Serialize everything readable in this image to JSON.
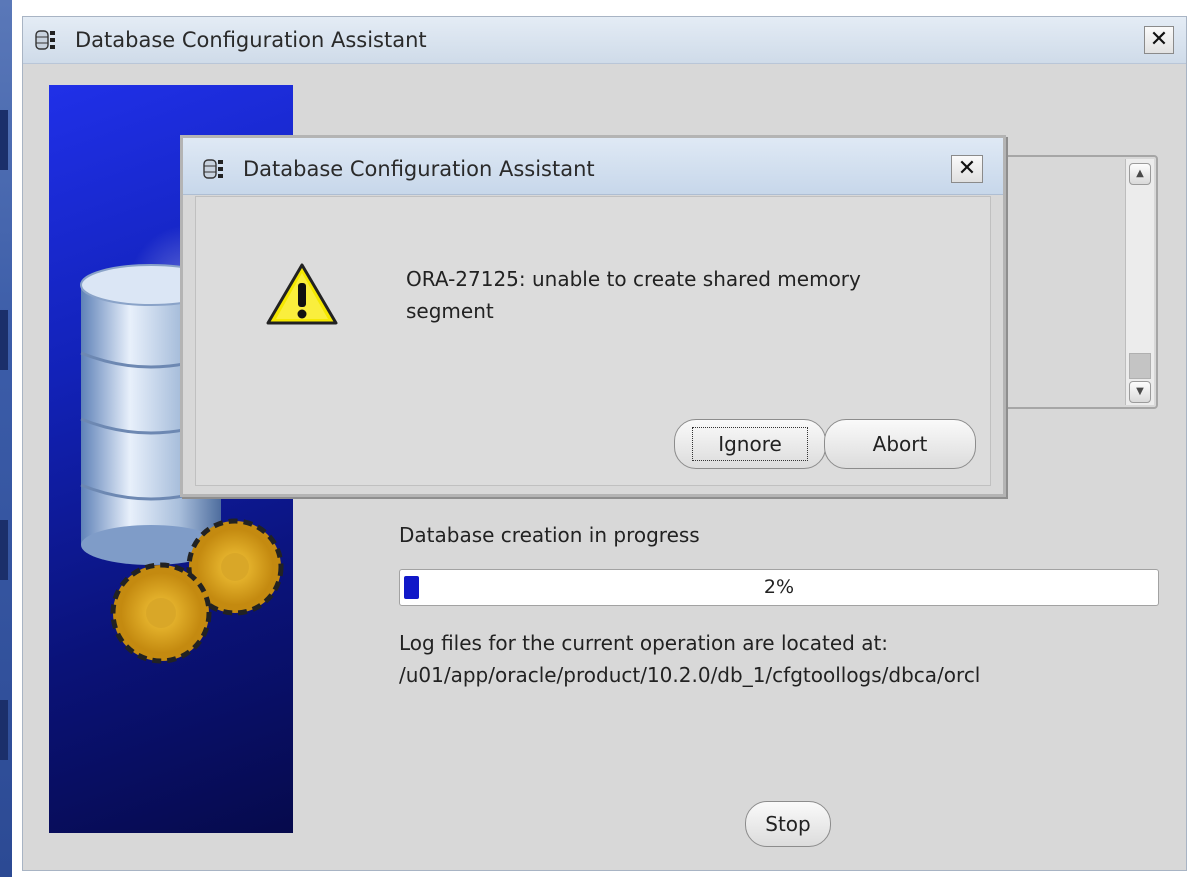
{
  "window": {
    "title": "Database Configuration Assistant",
    "close_label": "✕"
  },
  "details_panel": {
    "scroll_up": "▲",
    "scroll_down": "▼"
  },
  "progress": {
    "label": "Database creation in progress",
    "value": 0.02,
    "percent_text": "2%"
  },
  "log": {
    "line1": "Log files for the current operation are located at:",
    "line2": "/u01/app/oracle/product/10.2.0/db_1/cfgtoollogs/dbca/orcl"
  },
  "buttons": {
    "stop": "Stop"
  },
  "dialog": {
    "title": "Database Configuration Assistant",
    "close_label": "✕",
    "message_line1": "ORA-27125: unable to create shared memory",
    "message_line2": "segment",
    "ignore_label": "Ignore",
    "abort_label": "Abort"
  },
  "icons": {
    "app": "database-app-icon",
    "warning": "warning-triangle-icon"
  },
  "colors": {
    "progress_fill": "#1018c8",
    "side_art": "#1222b8",
    "warning_yellow": "#f5e800"
  }
}
